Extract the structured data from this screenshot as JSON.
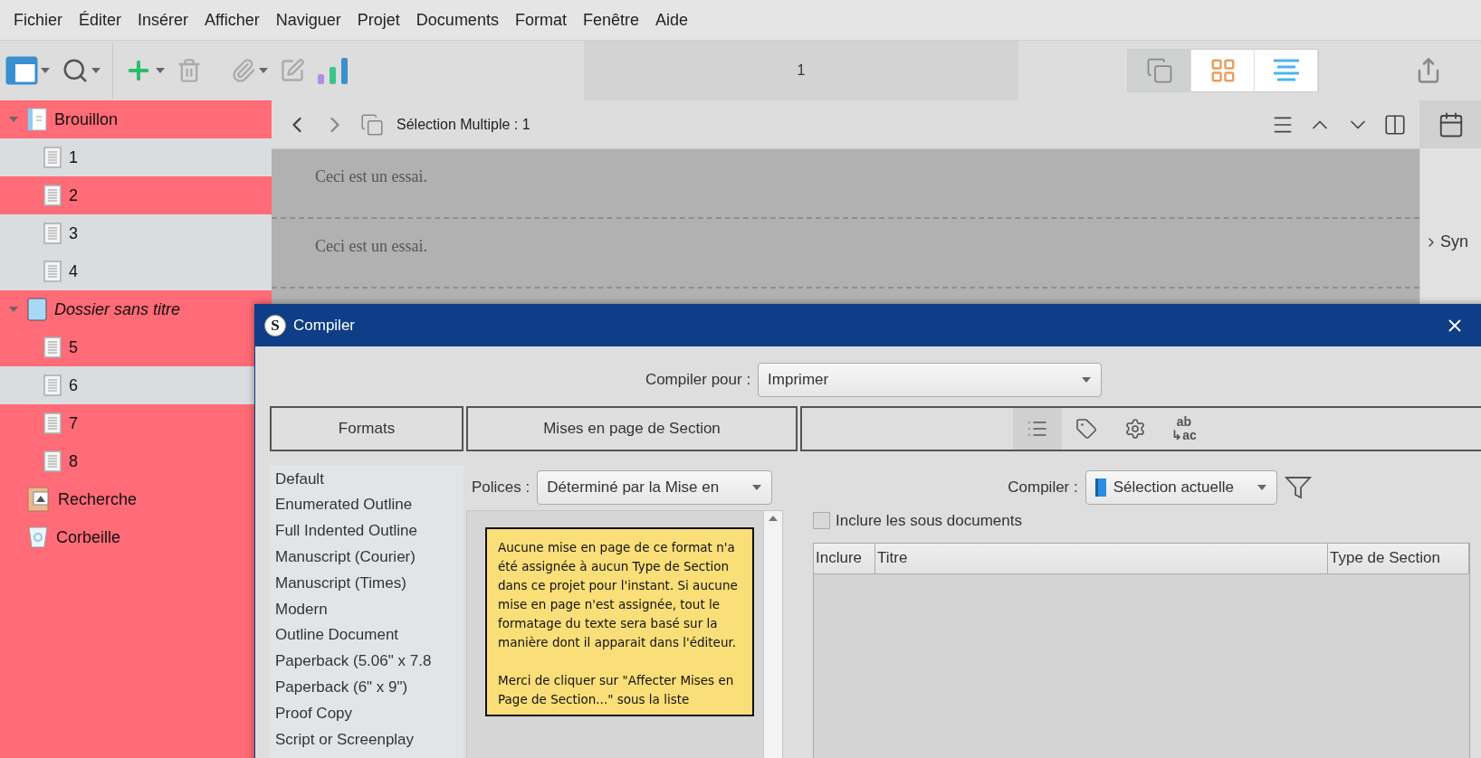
{
  "menu": [
    "Fichier",
    "Éditer",
    "Insérer",
    "Afficher",
    "Naviguer",
    "Projet",
    "Documents",
    "Format",
    "Fenêtre",
    "Aide"
  ],
  "toolbar": {
    "title": "1",
    "view_modes": [
      {
        "kind": "scrivenings",
        "selected": true
      },
      {
        "kind": "corkboard",
        "selected": false
      },
      {
        "kind": "outliner",
        "selected": false
      }
    ]
  },
  "binder": [
    {
      "label": "Brouillon",
      "kind": "draft",
      "selected": true,
      "expanded": true,
      "children": [
        {
          "label": "1",
          "kind": "document",
          "selected": false
        },
        {
          "label": "2",
          "kind": "document",
          "selected": true
        },
        {
          "label": "3",
          "kind": "document",
          "selected": false
        },
        {
          "label": "4",
          "kind": "document",
          "selected": false
        }
      ]
    },
    {
      "label": "Dossier sans titre",
      "kind": "folder",
      "selected": true,
      "expanded": true,
      "children": [
        {
          "label": "5",
          "kind": "document",
          "selected": true
        },
        {
          "label": "6",
          "kind": "document",
          "selected": false
        },
        {
          "label": "7",
          "kind": "document",
          "selected": true
        },
        {
          "label": "8",
          "kind": "document",
          "selected": true
        }
      ]
    },
    {
      "label": "Recherche",
      "kind": "research",
      "selected": true
    },
    {
      "label": "Corbeille",
      "kind": "trash",
      "selected": true
    }
  ],
  "editor": {
    "title": "Sélection Multiple : 1",
    "sections": [
      "Ceci est un essai.",
      "Ceci est un essai."
    ]
  },
  "inspector": {
    "label": "Syn"
  },
  "dialog": {
    "title": "Compiler",
    "logo": "S",
    "compile_for": {
      "label": "Compiler pour :",
      "value": "Imprimer"
    },
    "tabs": [
      "Formats",
      "Mises en page de Section"
    ],
    "panel_tabs": [
      {
        "kind": "contents",
        "selected": true
      },
      {
        "kind": "metadata",
        "selected": false
      },
      {
        "kind": "options",
        "selected": false
      },
      {
        "kind": "replacements",
        "selected": false,
        "top": "ab",
        "bottom": "↳ac"
      }
    ],
    "formats": [
      "Default",
      "Enumerated Outline",
      "Full Indented Outline",
      "Manuscript (Courier)",
      "Manuscript (Times)",
      "Modern",
      "Outline Document",
      "Paperback (5.06\" x 7.8",
      "Paperback (6\" x 9\")",
      "Proof Copy",
      "Script or Screenplay"
    ],
    "fonts": {
      "label": "Polices :",
      "value": "Déterminé par la Mise en"
    },
    "note": [
      "Aucune mise en page de ce format n'a été assignée à aucun Type de Section dans ce projet pour l'instant. Si aucune mise en page n'est assignée, tout le formatage du texte sera basé sur la manière dont il apparait dans l'éditeur.",
      "Merci de cliquer sur \"Affecter Mises en Page de Section...\" sous la liste"
    ],
    "compile": {
      "label": "Compiler :",
      "value": "Sélection actuelle"
    },
    "include_subdocs": {
      "label": "Inclure les sous documents",
      "checked": false
    },
    "table": {
      "columns": [
        "Inclure",
        "Titre",
        "Type de Section"
      ]
    }
  }
}
